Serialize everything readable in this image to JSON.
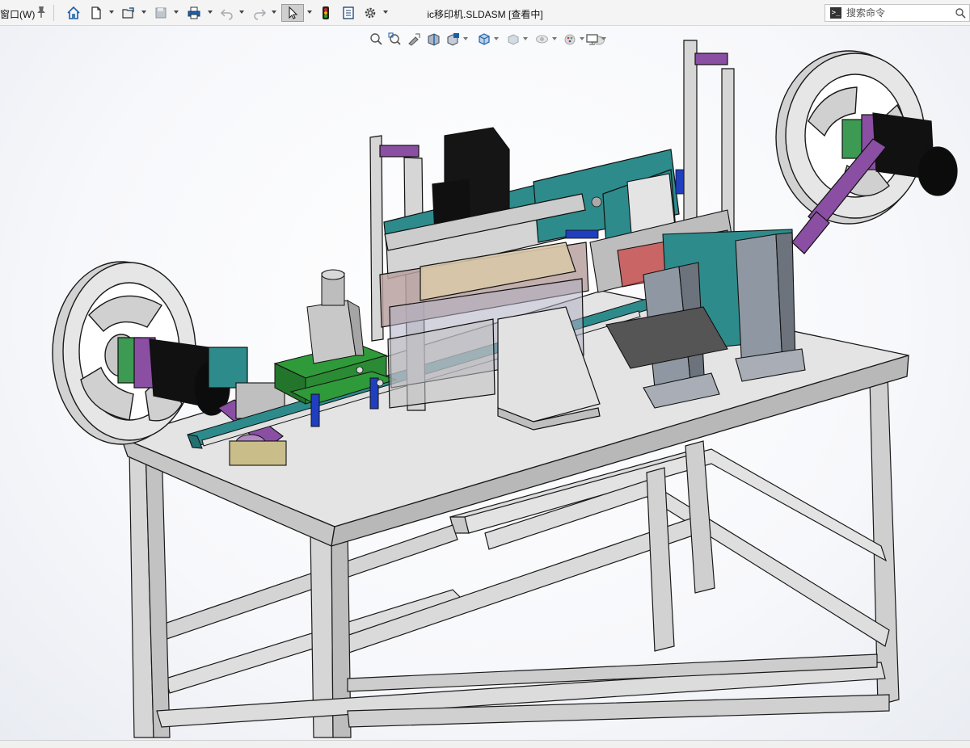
{
  "toolbar": {
    "window_menu_label": "窗口(W)",
    "document_title": "ic移印机.SLDASM [查看中]",
    "search": {
      "placeholder": "搜索命令"
    },
    "buttons": [
      {
        "name": "home-icon"
      },
      {
        "name": "new-document-icon"
      },
      {
        "name": "open-icon"
      },
      {
        "name": "save-icon"
      },
      {
        "name": "print-icon"
      },
      {
        "name": "undo-icon"
      },
      {
        "name": "redo-icon"
      },
      {
        "name": "select-icon"
      },
      {
        "name": "rebuild-traffic-light-icon"
      },
      {
        "name": "file-properties-icon"
      },
      {
        "name": "options-gear-icon"
      }
    ]
  },
  "view_toolbar": {
    "buttons": [
      {
        "name": "zoom-to-fit-icon"
      },
      {
        "name": "zoom-to-area-icon"
      },
      {
        "name": "previous-view-icon"
      },
      {
        "name": "section-view-icon"
      },
      {
        "name": "dynamic-annotation-icon"
      },
      {
        "name": "view-orientation-icon"
      },
      {
        "name": "display-style-icon"
      },
      {
        "name": "hide-show-items-icon"
      },
      {
        "name": "edit-appearance-icon"
      },
      {
        "name": "apply-scene-icon"
      },
      {
        "name": "view-settings-icon"
      }
    ]
  },
  "colors": {
    "frame": "#d8d8d8",
    "frame_edge": "#1a1a1a",
    "teal_plate": "#2e8b8b",
    "green_pcb": "#2f9a3a",
    "purple_link": "#8a4fa3",
    "blue_part": "#1f3fbf",
    "motor_black": "#111111"
  }
}
